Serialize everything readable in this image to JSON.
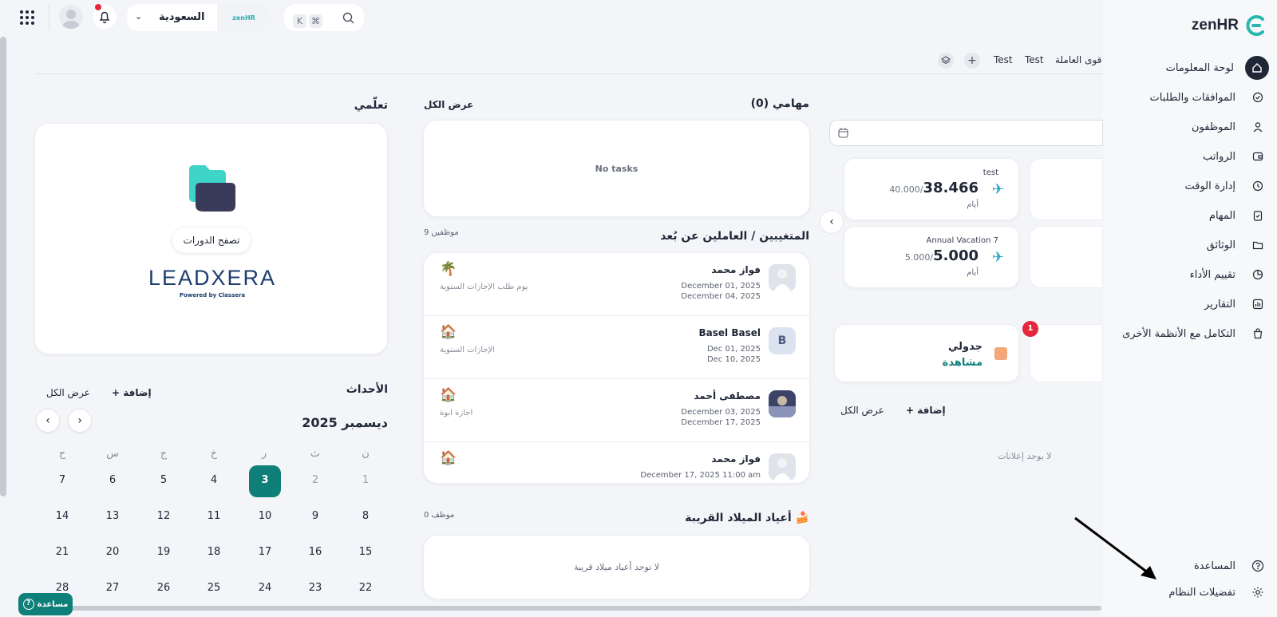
{
  "topbar": {
    "shortcut_keys": [
      "⌘",
      "K"
    ],
    "country": "السعودية",
    "brand_mini": "zenHR"
  },
  "sidebar": {
    "logo": "zenHR",
    "items": [
      {
        "label": "لوحة المعلومات",
        "icon": "home-icon",
        "active": true
      },
      {
        "label": "الموافقات والطلبات",
        "icon": "check-circle-icon"
      },
      {
        "label": "الموظفون",
        "icon": "user-icon"
      },
      {
        "label": "الرواتب",
        "icon": "wallet-icon"
      },
      {
        "label": "إدارة الوقت",
        "icon": "clock-icon"
      },
      {
        "label": "المهام",
        "icon": "clipboard-check-icon"
      },
      {
        "label": "الوثائق",
        "icon": "folder-icon"
      },
      {
        "label": "تقييم الأداء",
        "icon": "chart-pie-icon"
      },
      {
        "label": "التقارير",
        "icon": "bar-chart-icon"
      },
      {
        "label": "التكامل مع الأنظمة الأخرى",
        "icon": "bag-icon"
      }
    ],
    "bottom": [
      {
        "label": "المساعدة",
        "icon": "help-icon"
      },
      {
        "label": "تفضيلات النظام",
        "icon": "gear-icon"
      }
    ]
  },
  "tabs": [
    "قوى العاملة",
    "Test",
    "Test"
  ],
  "balances": [
    {
      "title": "test",
      "value": "38.466",
      "total": "40.000",
      "unit": "أيام"
    },
    {
      "title": "Annual Vacation 7",
      "value": "5.000",
      "total": "5.000",
      "unit": "أيام"
    }
  ],
  "schedule": {
    "title": "جدولي",
    "action": "مشاهدة",
    "badge": "1"
  },
  "announcements": {
    "add": "+ إضافة",
    "view_all": "عرض الكل",
    "empty": "لا يوجد إعلانات"
  },
  "tasks": {
    "title": "مهامي (0)",
    "view_all": "عرض الكل",
    "empty": "No tasks"
  },
  "remote": {
    "title": "المتغيبين / العاملين عن بُعد",
    "count": "9 موظفين",
    "rows": [
      {
        "name": "فواز محمد",
        "from": "December 01, 2025",
        "to": "December 04, 2025",
        "type": "يوم طلب الإجازات السنوية",
        "icon": "🌴",
        "avatar": "photo"
      },
      {
        "name": "Basel Basel",
        "from": "Dec 01, 2025",
        "to": "Dec 10, 2025",
        "type": "الإجازات السنوية",
        "icon": "🏠",
        "avatar": "B"
      },
      {
        "name": "مصطفى أحمد",
        "from": "December 03, 2025",
        "to": "December 17, 2025",
        "type": "اجازة ابوة",
        "icon": "🏠",
        "avatar": "photo"
      },
      {
        "name": "فواز محمد",
        "from": "December 17, 2025 11:00 am",
        "to": "",
        "type": "",
        "icon": "🏠",
        "avatar": "photo"
      }
    ]
  },
  "birthdays": {
    "title": "أعياد الميلاد القريبة",
    "count": "0 موظف",
    "empty": "لا توجد أعياد ميلاد قريبة"
  },
  "learning": {
    "title": "تعلّمي",
    "button": "تصفح الدورات",
    "brand_text": "LEADXERA",
    "powered": "Powered by Classera"
  },
  "events": {
    "title": "الأحداث",
    "add": "+ إضافة",
    "view_all": "عرض الكل",
    "month": "ديسمبر 2025"
  },
  "calendar": {
    "weekdays": [
      "ن",
      "ث",
      "ر",
      "خ",
      "ج",
      "س",
      "ح"
    ],
    "weeks": [
      [
        "1",
        "2",
        "3",
        "4",
        "5",
        "6",
        "7"
      ],
      [
        "8",
        "9",
        "10",
        "11",
        "12",
        "13",
        "14"
      ],
      [
        "15",
        "16",
        "17",
        "18",
        "19",
        "20",
        "21"
      ],
      [
        "22",
        "23",
        "24",
        "25",
        "26",
        "27",
        "28"
      ]
    ],
    "today": "3"
  },
  "help_button": "مساعدة",
  "colors": {
    "accent": "#0f7f7a",
    "dark": "#1f2636",
    "badge": "#e5263b"
  }
}
